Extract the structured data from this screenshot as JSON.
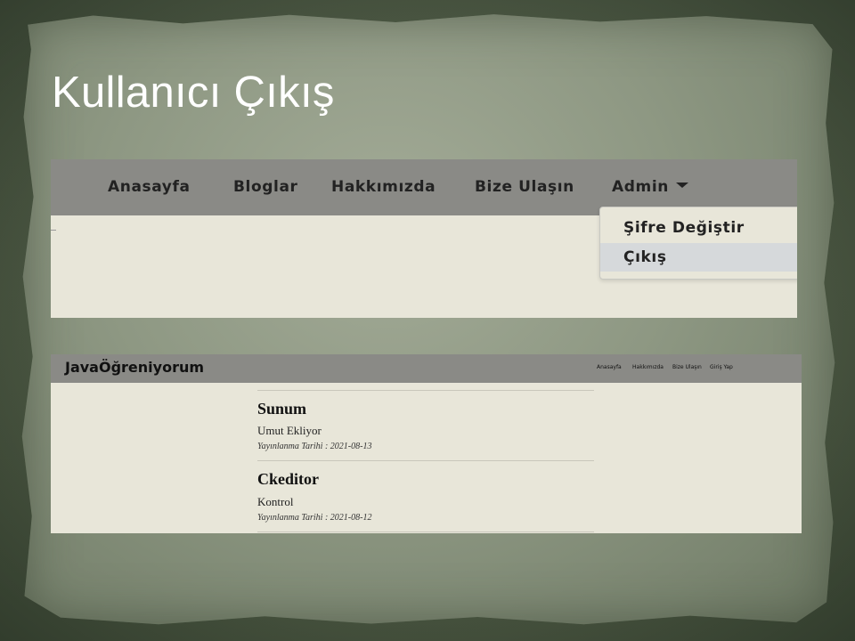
{
  "slide": {
    "title": "Kullanıcı Çıkış"
  },
  "screenshot1": {
    "nav": {
      "items": [
        "Anasayfa",
        "Bloglar",
        "Hakkımızda",
        "Bize Ulaşın"
      ],
      "admin_label": "Admin"
    },
    "dropdown": {
      "items": [
        "Şifre Değiştir",
        "Çıkış"
      ],
      "highlighted": "Çıkış"
    }
  },
  "screenshot2": {
    "brand": "JavaÖğreniyorum",
    "nav_items": [
      "Anasayfa",
      "Hakkımızda",
      "Bize Ulaşın",
      "Giriş Yap"
    ],
    "posts": [
      {
        "title": "Sunum",
        "subtitle": "Umut Ekliyor",
        "date": "Yayınlanma Tarihi : 2021-08-13"
      },
      {
        "title": "Ckeditor",
        "subtitle": "Kontrol",
        "date": "Yayınlanma Tarihi : 2021-08-12"
      }
    ]
  },
  "colors": {
    "background": "#4e5a45",
    "paper": "#8e9883",
    "navbar": "#8a8a86",
    "content": "#e8e6d9",
    "highlight": "#d6d9db"
  }
}
